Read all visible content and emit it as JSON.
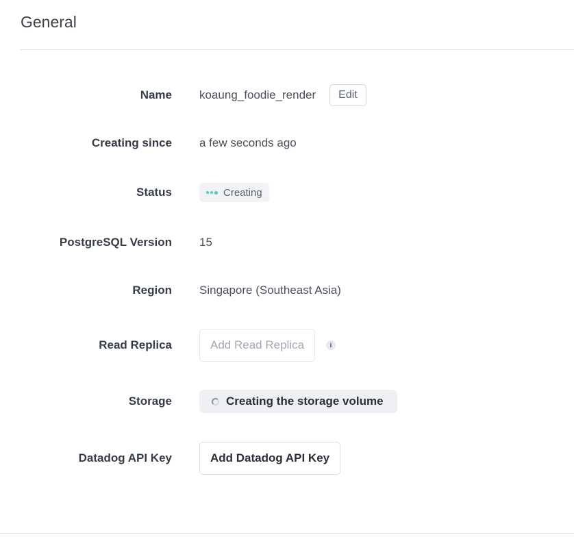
{
  "section": {
    "title": "General"
  },
  "fields": {
    "name": {
      "label": "Name",
      "value": "koaung_foodie_render",
      "edit_label": "Edit"
    },
    "creating_since": {
      "label": "Creating since",
      "value": "a few seconds ago"
    },
    "status": {
      "label": "Status",
      "value": "Creating",
      "indicator_color": "#3fd8b2"
    },
    "postgres_version": {
      "label": "PostgreSQL Version",
      "value": "15"
    },
    "region": {
      "label": "Region",
      "value": "Singapore (Southeast Asia)"
    },
    "read_replica": {
      "label": "Read Replica",
      "button_label": "Add Read Replica",
      "info_icon": "i"
    },
    "storage": {
      "label": "Storage",
      "value": "Creating the storage volume"
    },
    "datadog": {
      "label": "Datadog API Key",
      "button_label": "Add Datadog API Key"
    }
  }
}
